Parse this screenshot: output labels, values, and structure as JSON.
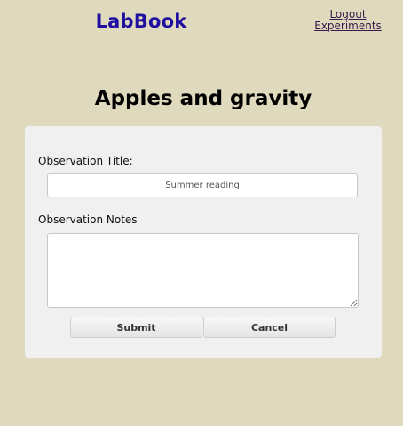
{
  "header": {
    "brand": "LabBook",
    "nav": {
      "logout": "Logout",
      "experiments": "Experiments"
    }
  },
  "page": {
    "title": "Apples and gravity"
  },
  "form": {
    "title_label": "Observation Title:",
    "title_placeholder": "Summer reading",
    "title_value": "",
    "notes_label": "Observation Notes",
    "notes_value": "",
    "submit_label": "Submit",
    "cancel_label": "Cancel"
  },
  "colors": {
    "background": "#dfd9bd",
    "brand": "#1f0fa0",
    "card": "#f0f0f0"
  }
}
